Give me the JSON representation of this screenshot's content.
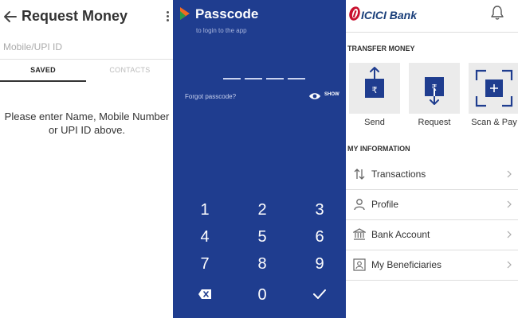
{
  "request_money": {
    "title": "Request Money",
    "search_placeholder": "Mobile/UPI ID",
    "tabs": [
      "SAVED",
      "CONTACTS"
    ],
    "message": "Please enter Name, Mobile Number or UPI ID above."
  },
  "passcode": {
    "title": "Passcode",
    "subtitle": "to login to the app",
    "digits_entered": 0,
    "forgot_label": "Forgot passcode?",
    "show_label": "SHOW",
    "keys": [
      "1",
      "2",
      "3",
      "4",
      "5",
      "6",
      "7",
      "8",
      "9",
      "0"
    ],
    "colors": {
      "background": "#1f3d8f"
    }
  },
  "icici": {
    "bank_name": "ICICI Bank",
    "transfer_heading": "TRANSFER MONEY",
    "transfer_actions": [
      "Send",
      "Request",
      "Scan & Pay"
    ],
    "info_heading": "MY INFORMATION",
    "info_items": [
      {
        "label": "Transactions",
        "icon": "arrows-icon"
      },
      {
        "label": "Profile",
        "icon": "person-icon"
      },
      {
        "label": "Bank Account",
        "icon": "bank-icon"
      },
      {
        "label": "My Beneficiaries",
        "icon": "contact-card-icon"
      }
    ],
    "colors": {
      "brand_red": "#c8102e",
      "brand_blue": "#1a3f7a",
      "accent_navy": "#1f3d8f"
    }
  }
}
